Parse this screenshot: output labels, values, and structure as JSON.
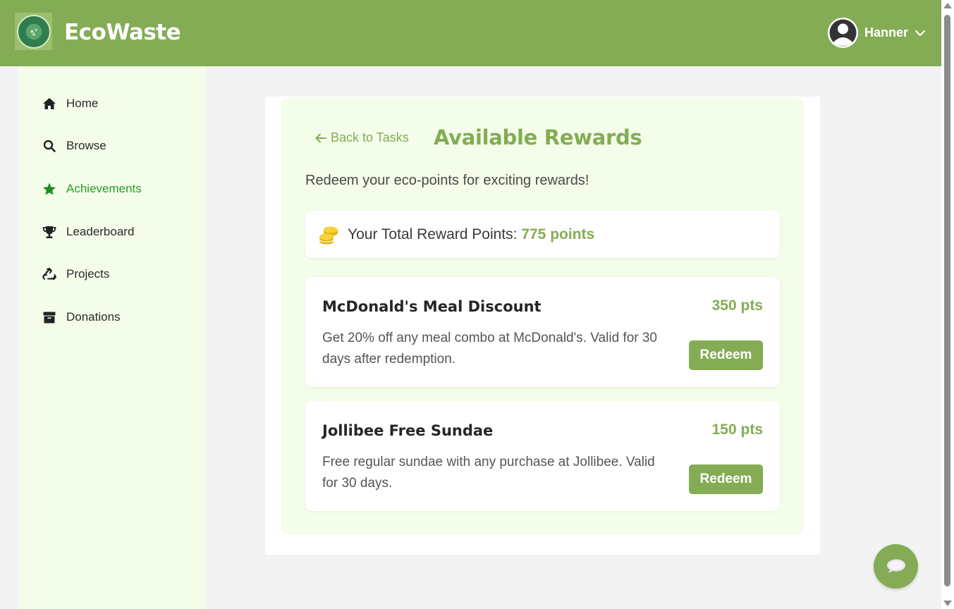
{
  "header": {
    "brand": "EcoWaste",
    "logo_icon": "recycle-globe-logo",
    "user_name": "Hanner",
    "bg_color": "#84ac54"
  },
  "sidebar": {
    "items": [
      {
        "label": "Home",
        "icon": "home-icon",
        "active": false
      },
      {
        "label": "Browse",
        "icon": "search-icon",
        "active": false
      },
      {
        "label": "Achievements",
        "icon": "star-icon",
        "active": true
      },
      {
        "label": "Leaderboard",
        "icon": "trophy-icon",
        "active": false
      },
      {
        "label": "Projects",
        "icon": "recycle-icon",
        "active": false
      },
      {
        "label": "Donations",
        "icon": "box-icon",
        "active": false
      }
    ]
  },
  "main": {
    "back_label": "Back to Tasks",
    "title": "Available Rewards",
    "subtitle": "Redeem your eco-points for exciting rewards!",
    "points_label": "Your Total Reward Points:",
    "points_value": "775 points",
    "rewards": [
      {
        "title": "McDonald's Meal Discount",
        "points": "350 pts",
        "description": "Get 20% off any meal combo at McDonald's. Valid for 30 days after redemption.",
        "button": "Redeem"
      },
      {
        "title": "Jollibee Free Sundae",
        "points": "150 pts",
        "description": "Free regular sundae with any purchase at Jollibee. Valid for 30 days.",
        "button": "Redeem"
      }
    ]
  },
  "colors": {
    "accent": "#84ac54",
    "active_nav": "#2a9a2a",
    "sidebar_bg": "#f3fde9",
    "coin": "#f5c518"
  }
}
